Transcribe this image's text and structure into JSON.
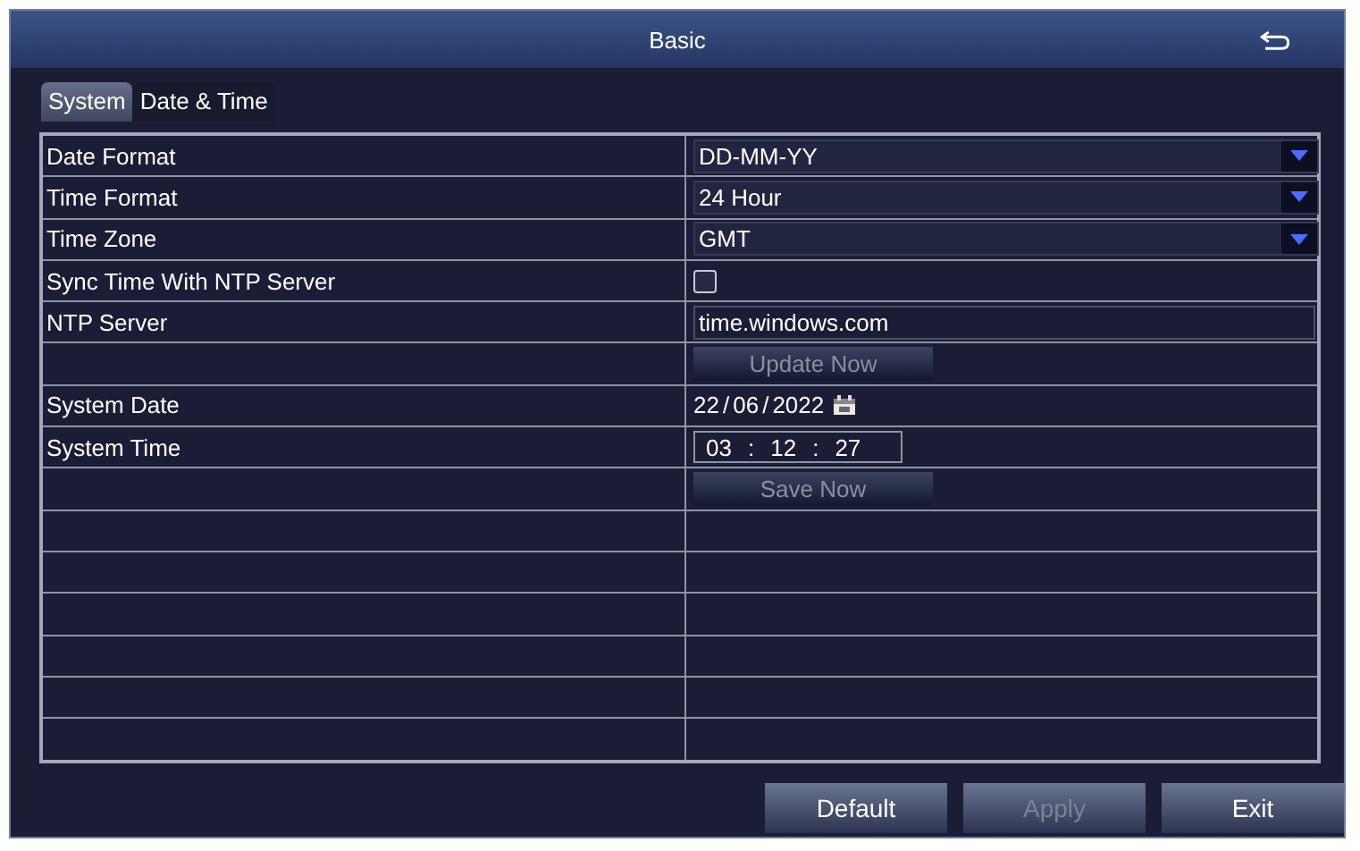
{
  "window": {
    "title": "Basic"
  },
  "tabs": [
    {
      "label": "System",
      "selected": true
    },
    {
      "label": "Date & Time",
      "selected": false
    }
  ],
  "rows": [
    {
      "kind": "select",
      "label": "Date Format",
      "value": "DD-MM-YY"
    },
    {
      "kind": "select",
      "label": "Time Format",
      "value": "24 Hour"
    },
    {
      "kind": "select",
      "label": "Time Zone",
      "value": "GMT"
    },
    {
      "kind": "checkbox",
      "label": "Sync Time With NTP Server",
      "checked": false
    },
    {
      "kind": "text",
      "label": "NTP Server",
      "value": "time.windows.com"
    },
    {
      "kind": "button",
      "label": "Update Now",
      "disabled": true
    },
    {
      "kind": "date",
      "label": "System Date",
      "segments": [
        "22",
        "/",
        "06",
        "/",
        "2022"
      ]
    },
    {
      "kind": "time",
      "label": "System Time",
      "segments": [
        "03",
        ":",
        "12",
        ":",
        "27"
      ]
    },
    {
      "kind": "button",
      "label": "Save Now",
      "disabled": true
    },
    {
      "kind": "blank"
    },
    {
      "kind": "blank"
    },
    {
      "kind": "blank"
    },
    {
      "kind": "blank"
    },
    {
      "kind": "blank"
    },
    {
      "kind": "blank"
    }
  ],
  "buttons": [
    {
      "label": "Default",
      "disabled": false
    },
    {
      "label": "Apply",
      "disabled": true
    },
    {
      "label": "Exit",
      "disabled": false
    }
  ]
}
